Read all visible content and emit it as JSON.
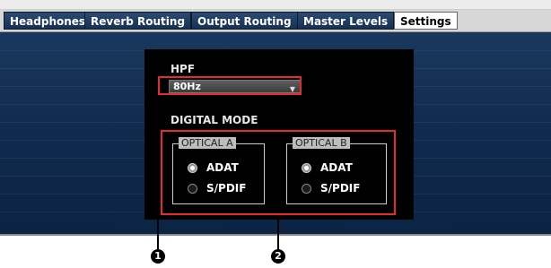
{
  "tabs": [
    {
      "label": "Headphones"
    },
    {
      "label": "Reverb Routing"
    },
    {
      "label": "Output Routing"
    },
    {
      "label": "Master Levels"
    },
    {
      "label": "Settings",
      "active": true
    }
  ],
  "hpf": {
    "label": "HPF",
    "value": "80Hz"
  },
  "digital_mode": {
    "label": "DIGITAL MODE",
    "optical_a": {
      "title": "OPTICAL A",
      "options": [
        "ADAT",
        "S/PDIF"
      ],
      "selected": "ADAT"
    },
    "optical_b": {
      "title": "OPTICAL B",
      "options": [
        "ADAT",
        "S/PDIF"
      ],
      "selected": "ADAT"
    }
  },
  "callouts": [
    "1",
    "2"
  ],
  "colors": {
    "accent_red": "#e52b2b",
    "panel_blue": "#143259"
  }
}
